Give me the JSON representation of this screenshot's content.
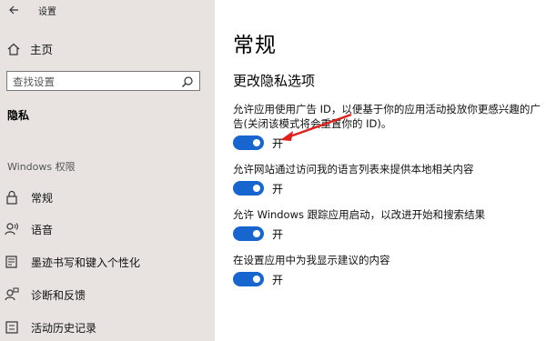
{
  "window": {
    "title": "设置"
  },
  "sidebar": {
    "home_label": "主页",
    "search_placeholder": "查找设置",
    "current_section": "隐私",
    "group_label": "Windows 权限",
    "items": [
      {
        "label": "常规",
        "icon": "lock-icon"
      },
      {
        "label": "语音",
        "icon": "speech-icon"
      },
      {
        "label": "墨迹书写和键入个性化",
        "icon": "inking-typing-icon"
      },
      {
        "label": "诊断和反馈",
        "icon": "diagnostics-feedback-icon"
      },
      {
        "label": "活动历史记录",
        "icon": "activity-history-icon"
      }
    ]
  },
  "main": {
    "title": "常规",
    "section_title": "更改隐私选项",
    "settings": [
      {
        "description": "允许应用使用广告 ID，以便基于你的应用活动投放你更感兴趣的广告(关闭该模式将会重置你的 ID)。",
        "state": "开",
        "on": true
      },
      {
        "description": "允许网站通过访问我的语言列表来提供本地相关内容",
        "state": "开",
        "on": true
      },
      {
        "description": "允许 Windows 跟踪应用启动，以改进开始和搜索结果",
        "state": "开",
        "on": true
      },
      {
        "description": "在设置应用中为我显示建议的内容",
        "state": "开",
        "on": true
      }
    ]
  },
  "annotation": {
    "arrow_color": "#e0201a"
  },
  "colors": {
    "accent": "#1766cf",
    "sidebar_bg": "#e8e3e1"
  }
}
